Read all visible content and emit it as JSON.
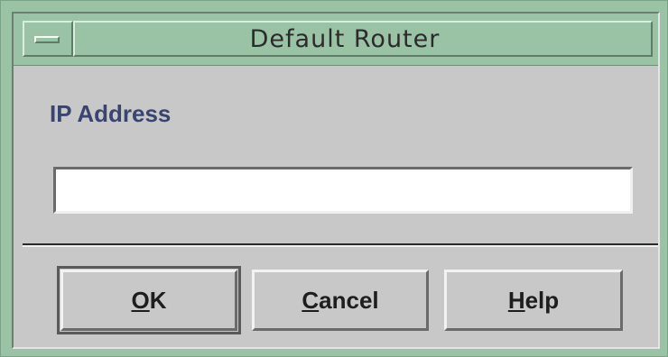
{
  "window": {
    "title": "Default Router",
    "menu_icon": "window-menu-icon"
  },
  "form": {
    "ip_label": "IP Address",
    "ip_value": ""
  },
  "buttons": {
    "ok": {
      "mnemonic": "O",
      "rest": "K"
    },
    "cancel": {
      "mnemonic": "C",
      "rest": "ancel"
    },
    "help": {
      "mnemonic": "H",
      "rest": "elp"
    }
  },
  "colors": {
    "titlebar": "#9ac3a6",
    "dialog_bg": "#c8c8c8",
    "label_text": "#3a4470"
  }
}
